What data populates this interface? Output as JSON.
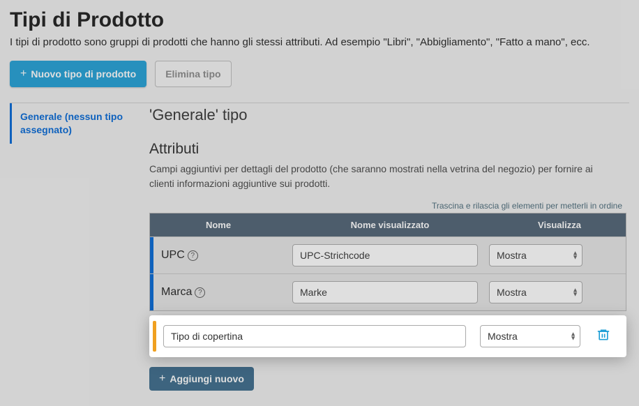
{
  "header": {
    "title": "Tipi di Prodotto",
    "subtitle": "I tipi di prodotto sono gruppi di prodotti che hanno gli stessi attributi. Ad esempio \"Libri\", \"Abbigliamento\", \"Fatto a mano\", ecc."
  },
  "buttons": {
    "new_type": "Nuovo tipo di prodotto",
    "delete_type": "Elimina tipo",
    "add_new": "Aggiungi nuovo"
  },
  "sidebar": {
    "items": [
      {
        "label": "Generale (nessun tipo assegnato)"
      }
    ]
  },
  "main": {
    "type_title": "'Generale' tipo",
    "attributes_heading": "Attributi",
    "attributes_desc": "Campi aggiuntivi per dettagli del prodotto (che saranno mostrati nella vetrina del negozio) per fornire ai clienti informazioni aggiuntive sui prodotti.",
    "drag_hint": "Trascina e rilascia gli elementi per metterli in ordine",
    "columns": {
      "name": "Nome",
      "display_name": "Nome visualizzato",
      "show": "Visualizza"
    },
    "rows": [
      {
        "name": "UPC",
        "display_value": "UPC-Strichcode",
        "show_value": "Mostra"
      },
      {
        "name": "Marca",
        "display_value": "Marke",
        "show_value": "Mostra"
      }
    ],
    "new_row": {
      "name_value": "Tipo di copertina",
      "show_value": "Mostra"
    }
  }
}
